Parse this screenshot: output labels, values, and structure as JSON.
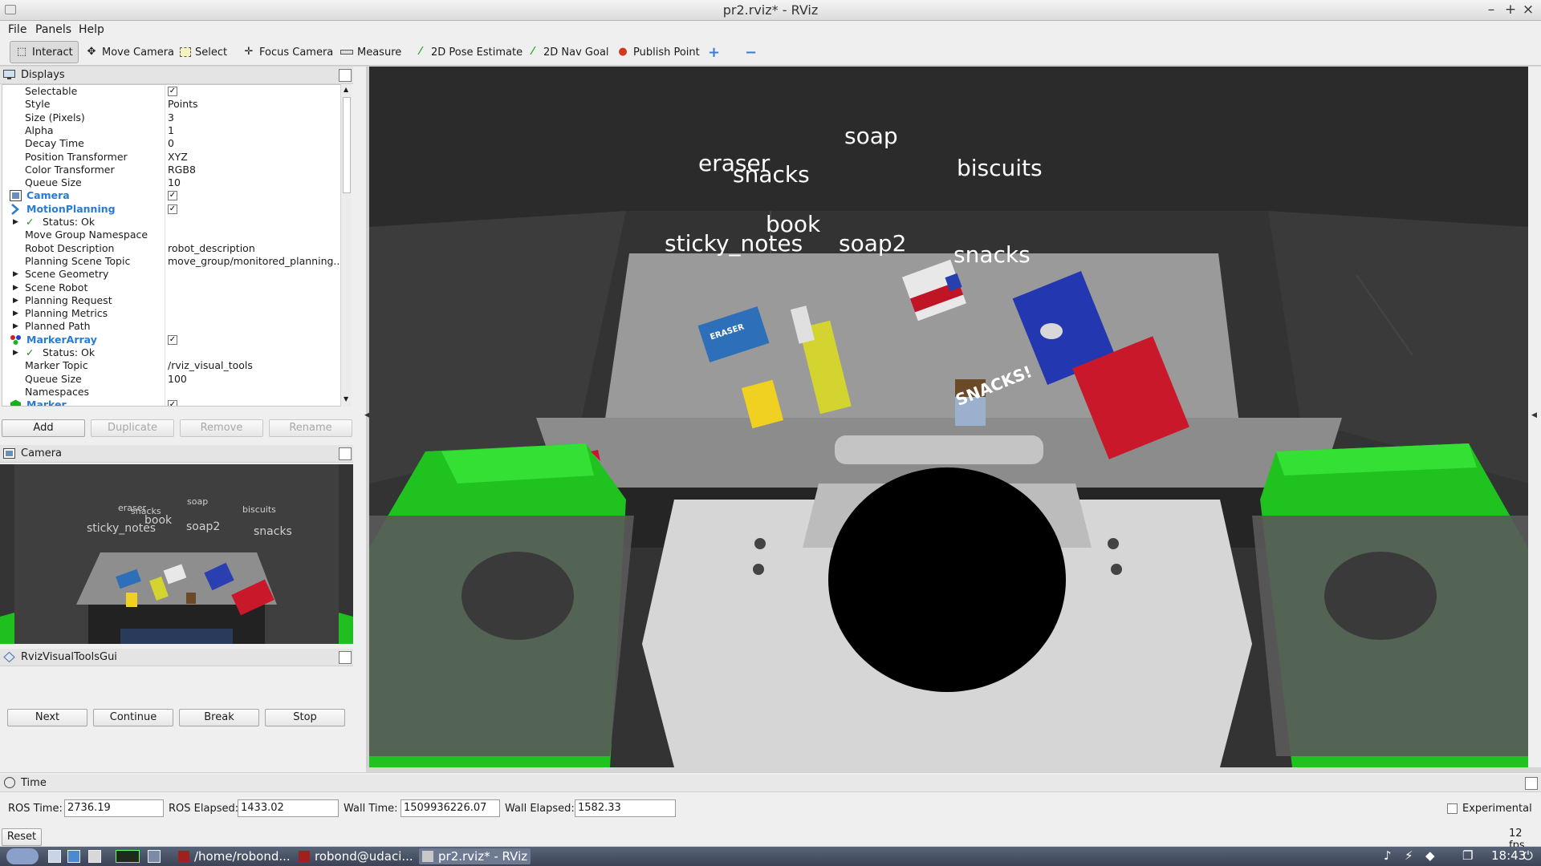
{
  "window": {
    "title": "pr2.rviz* - RViz",
    "min": "–",
    "max": "+",
    "close": "×"
  },
  "menu": [
    "File",
    "Panels",
    "Help"
  ],
  "toolbar": {
    "tools": [
      {
        "label": "Interact",
        "icon": "cursor"
      },
      {
        "label": "Move Camera",
        "icon": "move"
      },
      {
        "label": "Select",
        "icon": "select"
      },
      {
        "label": "Focus Camera",
        "icon": "focus"
      },
      {
        "label": "Measure",
        "icon": "ruler"
      },
      {
        "label": "2D Pose Estimate",
        "icon": "arrow-green"
      },
      {
        "label": "2D Nav Goal",
        "icon": "arrow-green"
      },
      {
        "label": "Publish Point",
        "icon": "pin-red"
      }
    ],
    "plus": "+",
    "minus": "−"
  },
  "displays": {
    "title": "Displays",
    "rows": [
      {
        "k": "Selectable",
        "v": "✓",
        "checkbox": true
      },
      {
        "k": "Style",
        "v": "Points"
      },
      {
        "k": "Size (Pixels)",
        "v": "3"
      },
      {
        "k": "Alpha",
        "v": "1"
      },
      {
        "k": "Decay Time",
        "v": "0"
      },
      {
        "k": "Position Transformer",
        "v": "XYZ"
      },
      {
        "k": "Color Transformer",
        "v": "RGB8"
      },
      {
        "k": "Queue Size",
        "v": "10"
      },
      {
        "k": "Camera",
        "v": "✓",
        "checkbox": true,
        "title": true
      },
      {
        "k": "MotionPlanning",
        "v": "✓",
        "checkbox": true,
        "title": true
      },
      {
        "k": "Status: Ok",
        "status": true
      },
      {
        "k": "Move Group Namespace",
        "v": ""
      },
      {
        "k": "Robot Description",
        "v": "robot_description"
      },
      {
        "k": "Planning Scene Topic",
        "v": "move_group/monitored_planning..."
      },
      {
        "k": "Scene Geometry",
        "expand": true
      },
      {
        "k": "Scene Robot",
        "expand": true
      },
      {
        "k": "Planning Request",
        "expand": true
      },
      {
        "k": "Planning Metrics",
        "expand": true
      },
      {
        "k": "Planned Path",
        "expand": true
      },
      {
        "k": "MarkerArray",
        "v": "✓",
        "checkbox": true,
        "title": true
      },
      {
        "k": "Status: Ok",
        "status": true
      },
      {
        "k": "Marker Topic",
        "v": "/rviz_visual_tools"
      },
      {
        "k": "Queue Size",
        "v": "100"
      },
      {
        "k": "Namespaces",
        "v": ""
      },
      {
        "k": "Marker",
        "v": "✓",
        "checkbox": true,
        "title": true
      }
    ],
    "buttons": {
      "add": "Add",
      "duplicate": "Duplicate",
      "remove": "Remove",
      "rename": "Rename"
    }
  },
  "camera_panel": {
    "title": "Camera"
  },
  "rvt_panel": {
    "title": "RvizVisualToolsGui",
    "buttons": {
      "next": "Next",
      "continue": "Continue",
      "break": "Break",
      "stop": "Stop"
    }
  },
  "scene_labels": {
    "soap": "soap",
    "eraser": "eraser",
    "snacks_top": "snacks",
    "biscuits": "biscuits",
    "book": "book",
    "sticky_notes": "sticky_notes",
    "soap2": "soap2",
    "snacks": "snacks"
  },
  "object_text": {
    "eraser_box": "ERASER",
    "snacks_box": "SNACKS!"
  },
  "time": {
    "title": "Time",
    "ros_time_label": "ROS Time:",
    "ros_time": "2736.19",
    "ros_elapsed_label": "ROS Elapsed:",
    "ros_elapsed": "1433.02",
    "wall_time_label": "Wall Time:",
    "wall_time": "1509936226.07",
    "wall_elapsed_label": "Wall Elapsed:",
    "wall_elapsed": "1582.33",
    "experimental": "Experimental",
    "reset": "Reset",
    "fps": "12 fps"
  },
  "taskbar": {
    "tasks": [
      "/home/robond...",
      "robond@udaci...",
      "pr2.rviz* - RViz"
    ],
    "clock": "18:43"
  }
}
